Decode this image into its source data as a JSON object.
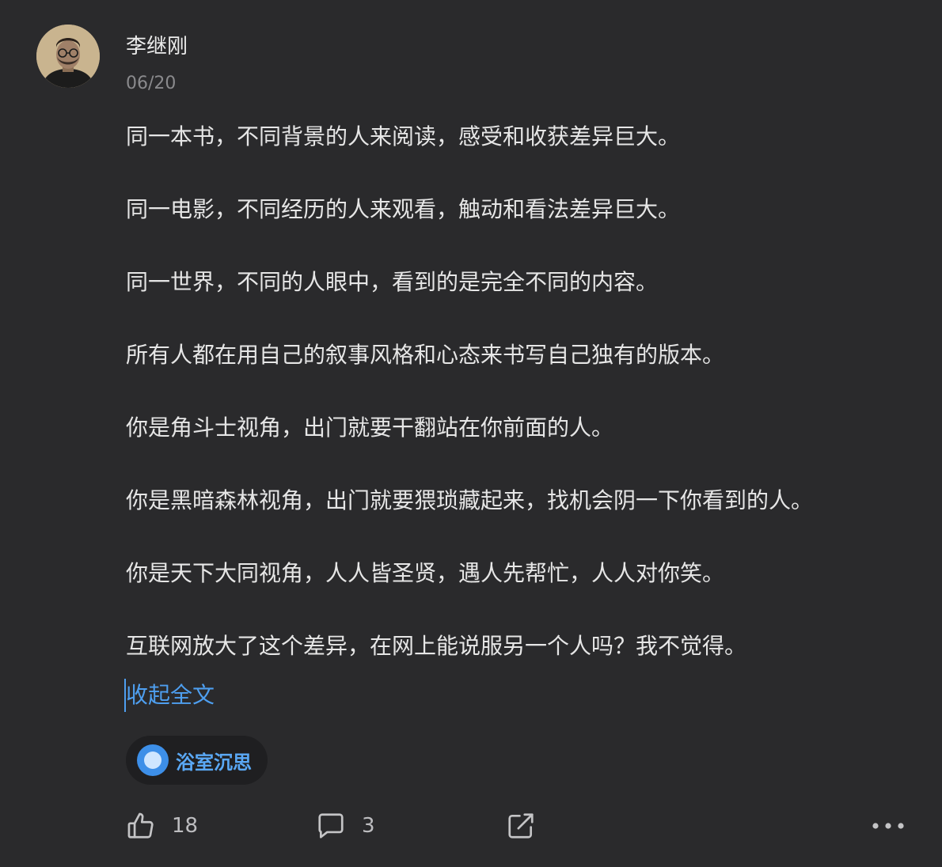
{
  "author": {
    "name": "李继刚",
    "date": "06/20"
  },
  "content": {
    "paragraphs": [
      "同一本书，不同背景的人来阅读，感受和收获差异巨大。",
      "同一电影，不同经历的人来观看，触动和看法差异巨大。",
      "同一世界，不同的人眼中，看到的是完全不同的内容。",
      "所有人都在用自己的叙事风格和心态来书写自己独有的版本。",
      "你是角斗士视角，出门就要干翻站在你前面的人。",
      "你是黑暗森林视角，出门就要猥琐藏起来，找机会阴一下你看到的人。",
      "你是天下大同视角，人人皆圣贤，遇人先帮忙，人人对你笑。",
      "互联网放大了这个差异，在网上能说服另一个人吗？我不觉得。"
    ],
    "collapse_label": "收起全文"
  },
  "topic": {
    "label": "浴室沉思",
    "icon": "topic-circle-icon"
  },
  "actions": {
    "likes": "18",
    "comments": "3",
    "like_icon": "thumbs-up-icon",
    "comment_icon": "comment-bubble-icon",
    "share_icon": "share-icon",
    "more_icon": "more-dots-icon"
  },
  "colors": {
    "background": "#2a2a2c",
    "text": "#e6e6e6",
    "muted": "#8a8a8d",
    "accent": "#4e9ff0",
    "chip_background": "#1f1f21"
  }
}
